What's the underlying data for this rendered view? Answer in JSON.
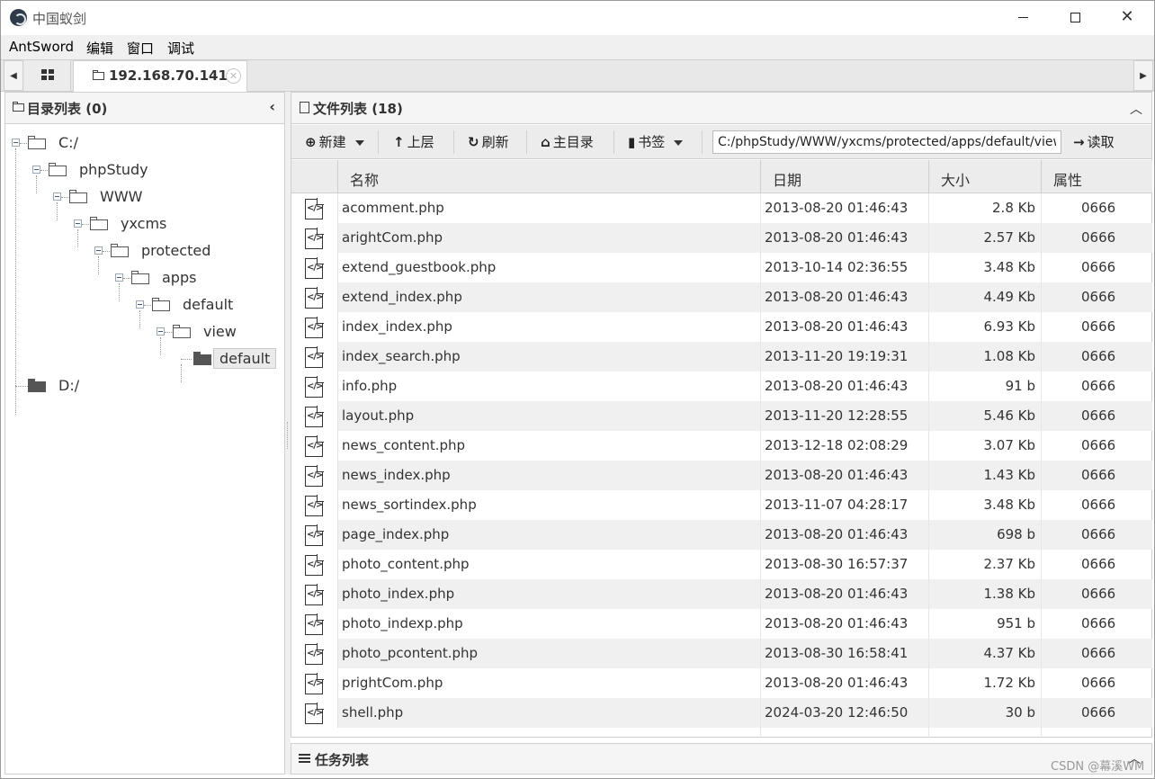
{
  "window": {
    "title": "中国蚁剑"
  },
  "menu": [
    "AntSword",
    "编辑",
    "窗口",
    "调试"
  ],
  "tab": {
    "label": "192.168.70.141"
  },
  "dir_panel": {
    "title": "目录列表 (0)",
    "tree": [
      {
        "label": "C:/"
      },
      {
        "label": "phpStudy"
      },
      {
        "label": "WWW"
      },
      {
        "label": "yxcms"
      },
      {
        "label": "protected"
      },
      {
        "label": "apps"
      },
      {
        "label": "default"
      },
      {
        "label": "view"
      },
      {
        "label": "default",
        "selected": true
      },
      {
        "label": "D:/"
      }
    ]
  },
  "file_panel": {
    "title": "文件列表 (18)",
    "toolbar": {
      "new": "新建",
      "up": "上层",
      "refresh": "刷新",
      "home": "主目录",
      "bookmarks": "书签",
      "path": "C:/phpStudy/WWW/yxcms/protected/apps/default/view/default/",
      "read": "读取"
    },
    "columns": [
      "名称",
      "日期",
      "大小",
      "属性"
    ],
    "files": [
      {
        "name": "acomment.php",
        "date": "2013-08-20 01:46:43",
        "size": "2.8 Kb",
        "attr": "0666"
      },
      {
        "name": "arightCom.php",
        "date": "2013-08-20 01:46:43",
        "size": "2.57 Kb",
        "attr": "0666"
      },
      {
        "name": "extend_guestbook.php",
        "date": "2013-10-14 02:36:55",
        "size": "3.48 Kb",
        "attr": "0666"
      },
      {
        "name": "extend_index.php",
        "date": "2013-08-20 01:46:43",
        "size": "4.49 Kb",
        "attr": "0666"
      },
      {
        "name": "index_index.php",
        "date": "2013-08-20 01:46:43",
        "size": "6.93 Kb",
        "attr": "0666"
      },
      {
        "name": "index_search.php",
        "date": "2013-11-20 19:19:31",
        "size": "1.08 Kb",
        "attr": "0666"
      },
      {
        "name": "info.php",
        "date": "2013-08-20 01:46:43",
        "size": "91 b",
        "attr": "0666"
      },
      {
        "name": "layout.php",
        "date": "2013-11-20 12:28:55",
        "size": "5.46 Kb",
        "attr": "0666"
      },
      {
        "name": "news_content.php",
        "date": "2013-12-18 02:08:29",
        "size": "3.07 Kb",
        "attr": "0666"
      },
      {
        "name": "news_index.php",
        "date": "2013-08-20 01:46:43",
        "size": "1.43 Kb",
        "attr": "0666"
      },
      {
        "name": "news_sortindex.php",
        "date": "2013-11-07 04:28:17",
        "size": "3.48 Kb",
        "attr": "0666"
      },
      {
        "name": "page_index.php",
        "date": "2013-08-20 01:46:43",
        "size": "698 b",
        "attr": "0666"
      },
      {
        "name": "photo_content.php",
        "date": "2013-08-30 16:57:37",
        "size": "2.37 Kb",
        "attr": "0666"
      },
      {
        "name": "photo_index.php",
        "date": "2013-08-20 01:46:43",
        "size": "1.38 Kb",
        "attr": "0666"
      },
      {
        "name": "photo_indexp.php",
        "date": "2013-08-20 01:46:43",
        "size": "951 b",
        "attr": "0666"
      },
      {
        "name": "photo_pcontent.php",
        "date": "2013-08-30 16:58:41",
        "size": "4.37 Kb",
        "attr": "0666"
      },
      {
        "name": "prightCom.php",
        "date": "2013-08-20 01:46:43",
        "size": "1.72 Kb",
        "attr": "0666"
      },
      {
        "name": "shell.php",
        "date": "2024-03-20 12:46:50",
        "size": "30 b",
        "attr": "0666"
      }
    ]
  },
  "task_panel": {
    "title": "任务列表"
  },
  "watermark": "CSDN @幕溪WM"
}
